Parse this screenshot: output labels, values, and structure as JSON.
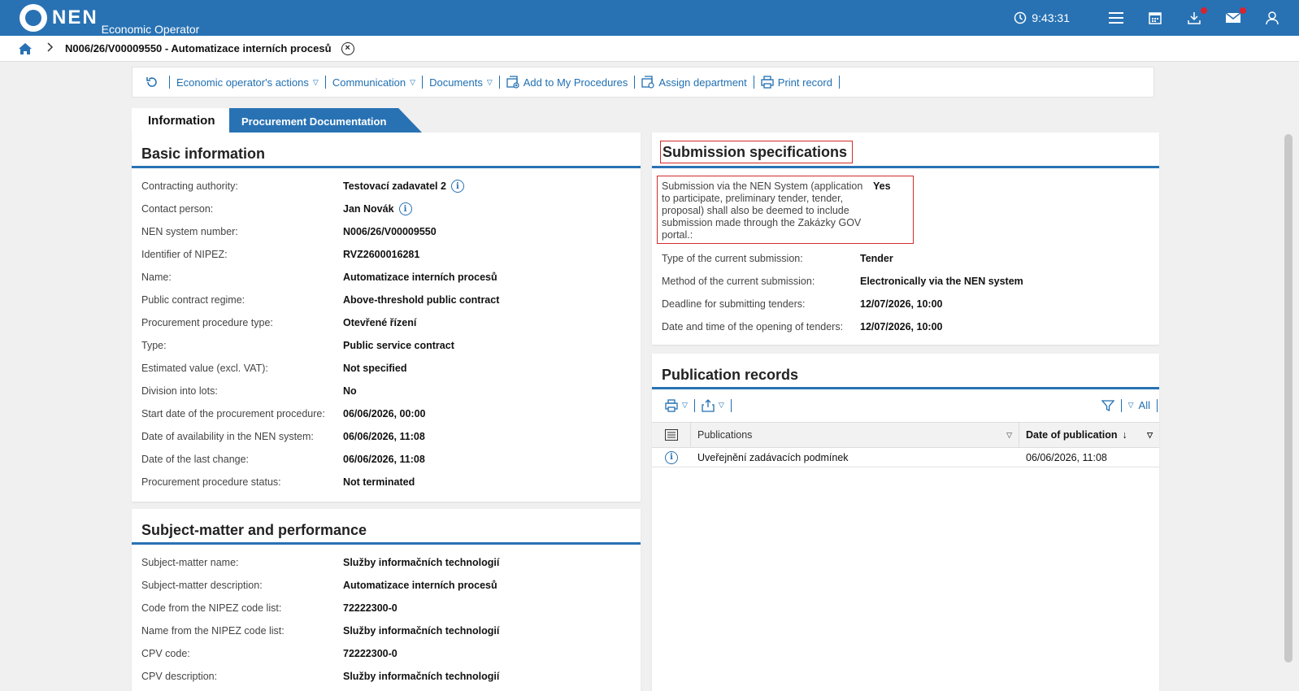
{
  "header": {
    "logo_text": "NEN",
    "logo_sub": "Economic Operator",
    "time": "9:43:31"
  },
  "breadcrumb": {
    "title": "N006/26/V00009550 - Automatizace interních procesů"
  },
  "toolbar": {
    "operator_actions": "Economic operator's actions",
    "communication": "Communication",
    "documents": "Documents",
    "add_to_my": "Add to My Procedures",
    "assign_department": "Assign department",
    "print_record": "Print record"
  },
  "tabs": {
    "information": "Information",
    "procurement_docs": "Procurement Documentation"
  },
  "basic_info": {
    "title": "Basic information",
    "rows": [
      {
        "label": "Contracting authority:",
        "value": "Testovací zadavatel 2"
      },
      {
        "label": "Contact person:",
        "value": "Jan Novák"
      },
      {
        "label": "NEN system number:",
        "value": "N006/26/V00009550"
      },
      {
        "label": "Identifier of NIPEZ:",
        "value": "RVZ2600016281"
      },
      {
        "label": "Name:",
        "value": "Automatizace interních procesů"
      },
      {
        "label": "Public contract regime:",
        "value": "Above-threshold public contract"
      },
      {
        "label": "Procurement procedure type:",
        "value": "Otevřené řízení"
      },
      {
        "label": "Type:",
        "value": "Public service contract"
      },
      {
        "label": "Estimated value (excl. VAT):",
        "value": "Not specified"
      },
      {
        "label": "Division into lots:",
        "value": "No"
      },
      {
        "label": "Start date of the procurement procedure:",
        "value": "06/06/2026, 00:00"
      },
      {
        "label": "Date of availability in the NEN system:",
        "value": "06/06/2026, 11:08"
      },
      {
        "label": "Date of the last change:",
        "value": "06/06/2026, 11:08"
      },
      {
        "label": "Procurement procedure status:",
        "value": "Not terminated"
      }
    ]
  },
  "subject_matter": {
    "title": "Subject-matter and performance",
    "rows": [
      {
        "label": "Subject-matter name:",
        "value": "Služby informačních technologií"
      },
      {
        "label": "Subject-matter description:",
        "value": "Automatizace interních procesů"
      },
      {
        "label": "Code from the NIPEZ code list:",
        "value": "72222300-0"
      },
      {
        "label": "Name from the NIPEZ code list:",
        "value": "Služby informačních technologií"
      },
      {
        "label": "CPV code:",
        "value": "72222300-0"
      },
      {
        "label": "CPV description:",
        "value": "Služby informačních technologií"
      }
    ]
  },
  "submission": {
    "title": "Submission specifications",
    "nen_label": "Submission via the NEN System (application to participate, preliminary tender, tender, proposal) shall also be deemed to include submission made through the Zakázky GOV portal.:",
    "nen_value": "Yes",
    "rows": [
      {
        "label": "Type of the current submission:",
        "value": "Tender"
      },
      {
        "label": "Method of the current submission:",
        "value": "Electronically via the NEN system"
      },
      {
        "label": "Deadline for submitting tenders:",
        "value": "12/07/2026, 10:00"
      },
      {
        "label": "Date and time of the opening of tenders:",
        "value": "12/07/2026, 10:00"
      }
    ]
  },
  "publication": {
    "title": "Publication records",
    "filter_all": "All",
    "col_publications": "Publications",
    "col_date": "Date of publication",
    "rows": [
      {
        "publication": "Uveřejnění zadávacích podmínek",
        "date": "06/06/2026, 11:08"
      }
    ]
  }
}
